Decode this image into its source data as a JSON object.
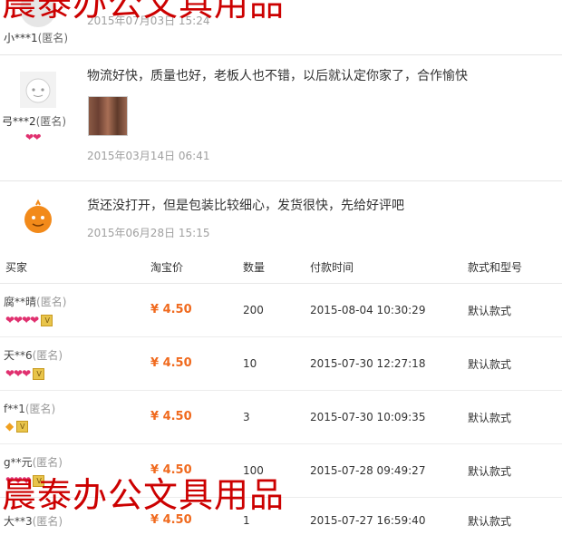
{
  "watermark": "晨泰办公文具用品",
  "reviews": [
    {
      "user": "小***1",
      "anon": "(匿名)",
      "text": "",
      "date": "2015年07月03日 15:24"
    },
    {
      "user": "弓***2",
      "anon": "(匿名)",
      "text": "物流好快，质量也好，老板人也不错，以后就认定你家了，合作愉快",
      "date": "2015年03月14日 06:41",
      "hearts": "❤❤"
    },
    {
      "user": "",
      "anon": "",
      "text": "货还没打开，但是包装比较细心，发货很快，先给好评吧",
      "date": "2015年06月28日 15:15"
    }
  ],
  "table": {
    "headers": {
      "buyer": "买家",
      "price": "淘宝价",
      "qty": "数量",
      "time": "付款时间",
      "style": "款式和型号"
    },
    "rows": [
      {
        "buyer": "腐**晴",
        "anon": "(匿名)",
        "price": "¥ 4.50",
        "qty": "200",
        "time": "2015-08-04 10:30:29",
        "style": "默认款式",
        "rank": "❤❤❤❤"
      },
      {
        "buyer": "天**6",
        "anon": "(匿名)",
        "price": "¥ 4.50",
        "qty": "10",
        "time": "2015-07-30 12:27:18",
        "style": "默认款式",
        "rank": "❤❤❤"
      },
      {
        "buyer": "f**1",
        "anon": "(匿名)",
        "price": "¥ 4.50",
        "qty": "3",
        "time": "2015-07-30 10:09:35",
        "style": "默认款式",
        "rank": ""
      },
      {
        "buyer": "g**元",
        "anon": "(匿名)",
        "price": "¥ 4.50",
        "qty": "100",
        "time": "2015-07-28 09:49:27",
        "style": "默认款式",
        "rank": "❤❤❤"
      },
      {
        "buyer": "大**3",
        "anon": "(匿名)",
        "price": "¥ 4.50",
        "qty": "1",
        "time": "2015-07-27 16:59:40",
        "style": "默认款式",
        "rank": ""
      }
    ]
  },
  "colors": {
    "watermark": "#cc0000",
    "price": "#f06a1e",
    "heart": "#e0306f"
  }
}
